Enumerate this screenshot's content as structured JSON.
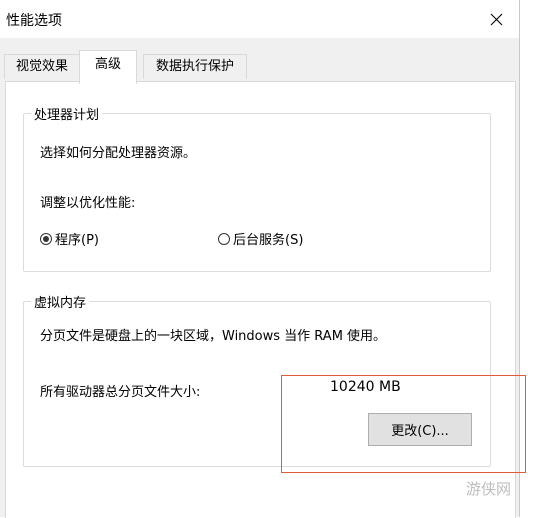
{
  "window": {
    "title": "性能选项",
    "close_glyph": "×"
  },
  "tabs": [
    {
      "label": "视觉效果",
      "active": false
    },
    {
      "label": "高级",
      "active": true
    },
    {
      "label": "数据执行保护",
      "active": false
    }
  ],
  "processor_scheduling": {
    "title": "处理器计划",
    "description": "选择如何分配处理器资源。",
    "adjust_label": "调整以优化性能:",
    "options": [
      {
        "label": "程序(P)",
        "selected": true
      },
      {
        "label": "后台服务(S)",
        "selected": false
      }
    ]
  },
  "virtual_memory": {
    "title": "虚拟内存",
    "description": "分页文件是硬盘上的一块区域，Windows 当作 RAM 使用。",
    "total_label": "所有驱动器总分页文件大小:",
    "total_value": "10240 MB",
    "change_button": "更改(C)..."
  },
  "watermark": "游侠网",
  "colors": {
    "highlight": "#e05a3c",
    "client_bg": "#f0f0f0",
    "button_bg": "#e1e1e1"
  },
  "icons": {
    "close": "close-icon"
  }
}
